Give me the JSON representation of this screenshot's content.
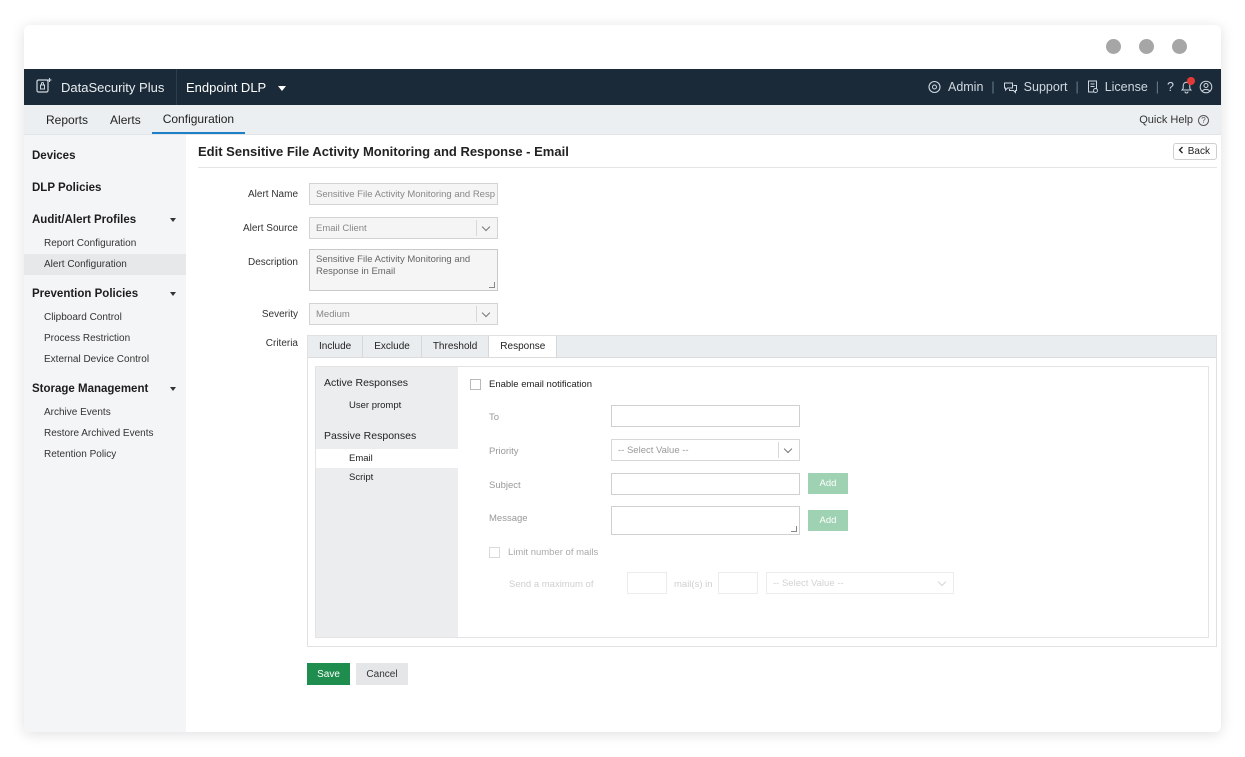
{
  "header": {
    "brand": "DataSecurity Plus",
    "product": "Endpoint DLP",
    "admin": "Admin",
    "support": "Support",
    "license": "License",
    "help": "?"
  },
  "nav": {
    "tabs": [
      "Reports",
      "Alerts",
      "Configuration"
    ],
    "active_tab": "Configuration",
    "quick_help": "Quick Help"
  },
  "sidebar": {
    "devices": "Devices",
    "dlp_policies": "DLP Policies",
    "audit_group": {
      "title": "Audit/Alert Profiles",
      "items": [
        "Report Configuration",
        "Alert Configuration"
      ]
    },
    "prevention_group": {
      "title": "Prevention Policies",
      "items": [
        "Clipboard Control",
        "Process Restriction",
        "External Device Control"
      ]
    },
    "storage_group": {
      "title": "Storage Management",
      "items": [
        "Archive Events",
        "Restore Archived Events",
        "Retention Policy"
      ]
    },
    "active_item": "Alert Configuration"
  },
  "page": {
    "title": "Edit Sensitive File Activity Monitoring and Response - Email",
    "back_label": "Back"
  },
  "form": {
    "alert_name_label": "Alert Name",
    "alert_name_value": "Sensitive File Activity Monitoring and Resp",
    "alert_source_label": "Alert Source",
    "alert_source_value": "Email Client",
    "description_label": "Description",
    "description_value": "Sensitive File Activity Monitoring and Response in Email",
    "severity_label": "Severity",
    "severity_value": "Medium",
    "criteria_label": "Criteria"
  },
  "criteria": {
    "tabs": [
      "Include",
      "Exclude",
      "Threshold",
      "Response"
    ],
    "active_tab": "Response",
    "active_responses_title": "Active Responses",
    "active_items": [
      "User prompt"
    ],
    "passive_responses_title": "Passive Responses",
    "passive_items": [
      "Email",
      "Script"
    ],
    "active_passive_item": "Email"
  },
  "response": {
    "enable_email_label": "Enable email notification",
    "to_label": "To",
    "priority_label": "Priority",
    "priority_placeholder": "-- Select Value --",
    "subject_label": "Subject",
    "message_label": "Message",
    "add_label": "Add",
    "limit_label": "Limit number of mails",
    "send_max_label": "Send a maximum of",
    "mails_in_label": "mail(s) in",
    "interval_placeholder": "-- Select Value --"
  },
  "actions": {
    "save": "Save",
    "cancel": "Cancel"
  },
  "colors": {
    "topbar": "#1b2a38",
    "accent": "#1e7fc9",
    "save": "#1f8d4e",
    "add_disabled": "#9fd2b2"
  }
}
